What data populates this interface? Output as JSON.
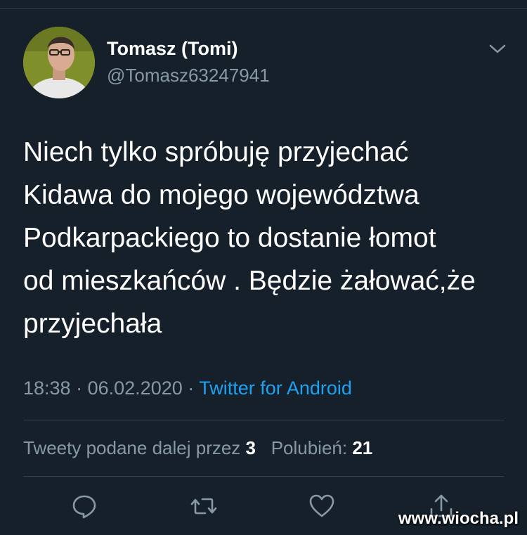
{
  "tweet": {
    "author_name": "Tomasz (Tomi)",
    "author_handle": "@Tomasz63247941",
    "text_lines": [
      "Niech tylko spróbuję przyjechać",
      "Kidawa do mojego województwa",
      "Podkarpackiego to dostanie łomot",
      "od mieszkańców . Będzie żałować,że",
      "przyjechała"
    ],
    "time": "18:38",
    "date": "06.02.2020",
    "separator": "·",
    "source": "Twitter for Android",
    "retweets_label": "Tweety podane dalej przez",
    "retweets_count": "3",
    "likes_label": "Polubień:",
    "likes_count": "21"
  },
  "actions": {
    "reply_icon": "reply-icon",
    "retweet_icon": "retweet-icon",
    "like_icon": "heart-icon",
    "share_icon": "share-icon"
  },
  "watermark": "www.wiocha.pl",
  "colors": {
    "background": "#15202b",
    "secondary_text": "#8899a6",
    "link": "#1da1f2"
  }
}
